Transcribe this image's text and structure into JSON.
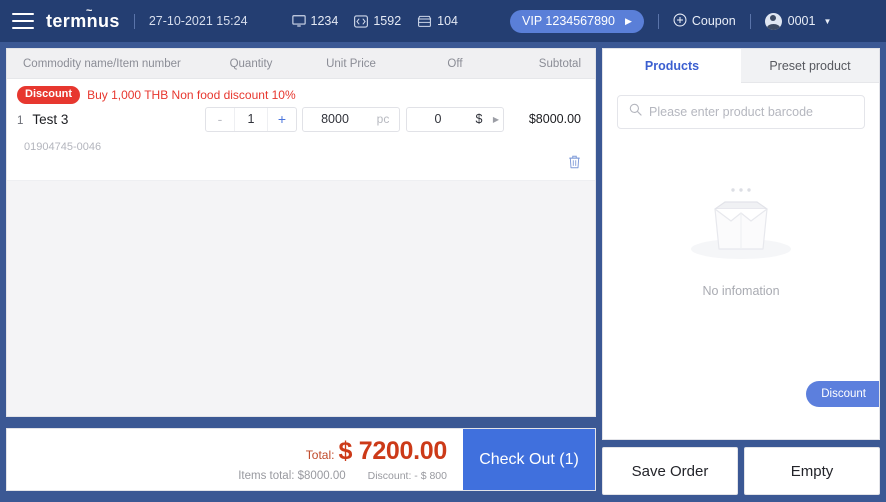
{
  "header": {
    "menu_icon": "hamburger-icon",
    "logo": "termnus",
    "datetime": "27-10-2021 15:24",
    "stats": [
      {
        "icon": "monitor-icon",
        "value": "1234"
      },
      {
        "icon": "code-badge-icon",
        "value": "1592"
      },
      {
        "icon": "store-icon",
        "value": "104"
      }
    ],
    "vip_label": "VIP 1234567890",
    "coupon_label": "Coupon",
    "user_id": "0001"
  },
  "cart": {
    "columns": {
      "name": "Commodity name/Item number",
      "quantity": "Quantity",
      "unit_price": "Unit Price",
      "off": "Off",
      "subtotal": "Subtotal"
    },
    "items": [
      {
        "index": "1",
        "promo_badge": "Discount",
        "promo_text": "Buy 1,000 THB Non food discount 10%",
        "name": "Test 3",
        "code": "01904745-0046",
        "qty_minus": "-",
        "qty_value": "1",
        "qty_plus": "+",
        "unit_price": "8000",
        "unit": "pc",
        "off_value": "0",
        "off_currency": "$",
        "subtotal": "$8000.00"
      }
    ]
  },
  "totals": {
    "label": "Total:",
    "amount": "$ 7200.00",
    "items_total": "Items total: $8000.00",
    "discount": "Discount: - $ 800",
    "checkout_label": "Check Out (1)"
  },
  "right_panel": {
    "tabs": [
      {
        "label": "Products",
        "active": true
      },
      {
        "label": "Preset product",
        "active": false
      }
    ],
    "search_placeholder": "Please enter product barcode",
    "search_value": "",
    "empty_text": "No infomation",
    "discount_fab": "Discount"
  },
  "bottom_buttons": [
    {
      "label": "Save Order"
    },
    {
      "label": "Empty"
    }
  ],
  "colors": {
    "header_bg": "#243e72",
    "frame_bg": "#3b5894",
    "accent_blue": "#4070dd",
    "promo_red": "#e7372f",
    "total_red": "#cc3a18",
    "vip_pill": "#5a7fd8"
  }
}
